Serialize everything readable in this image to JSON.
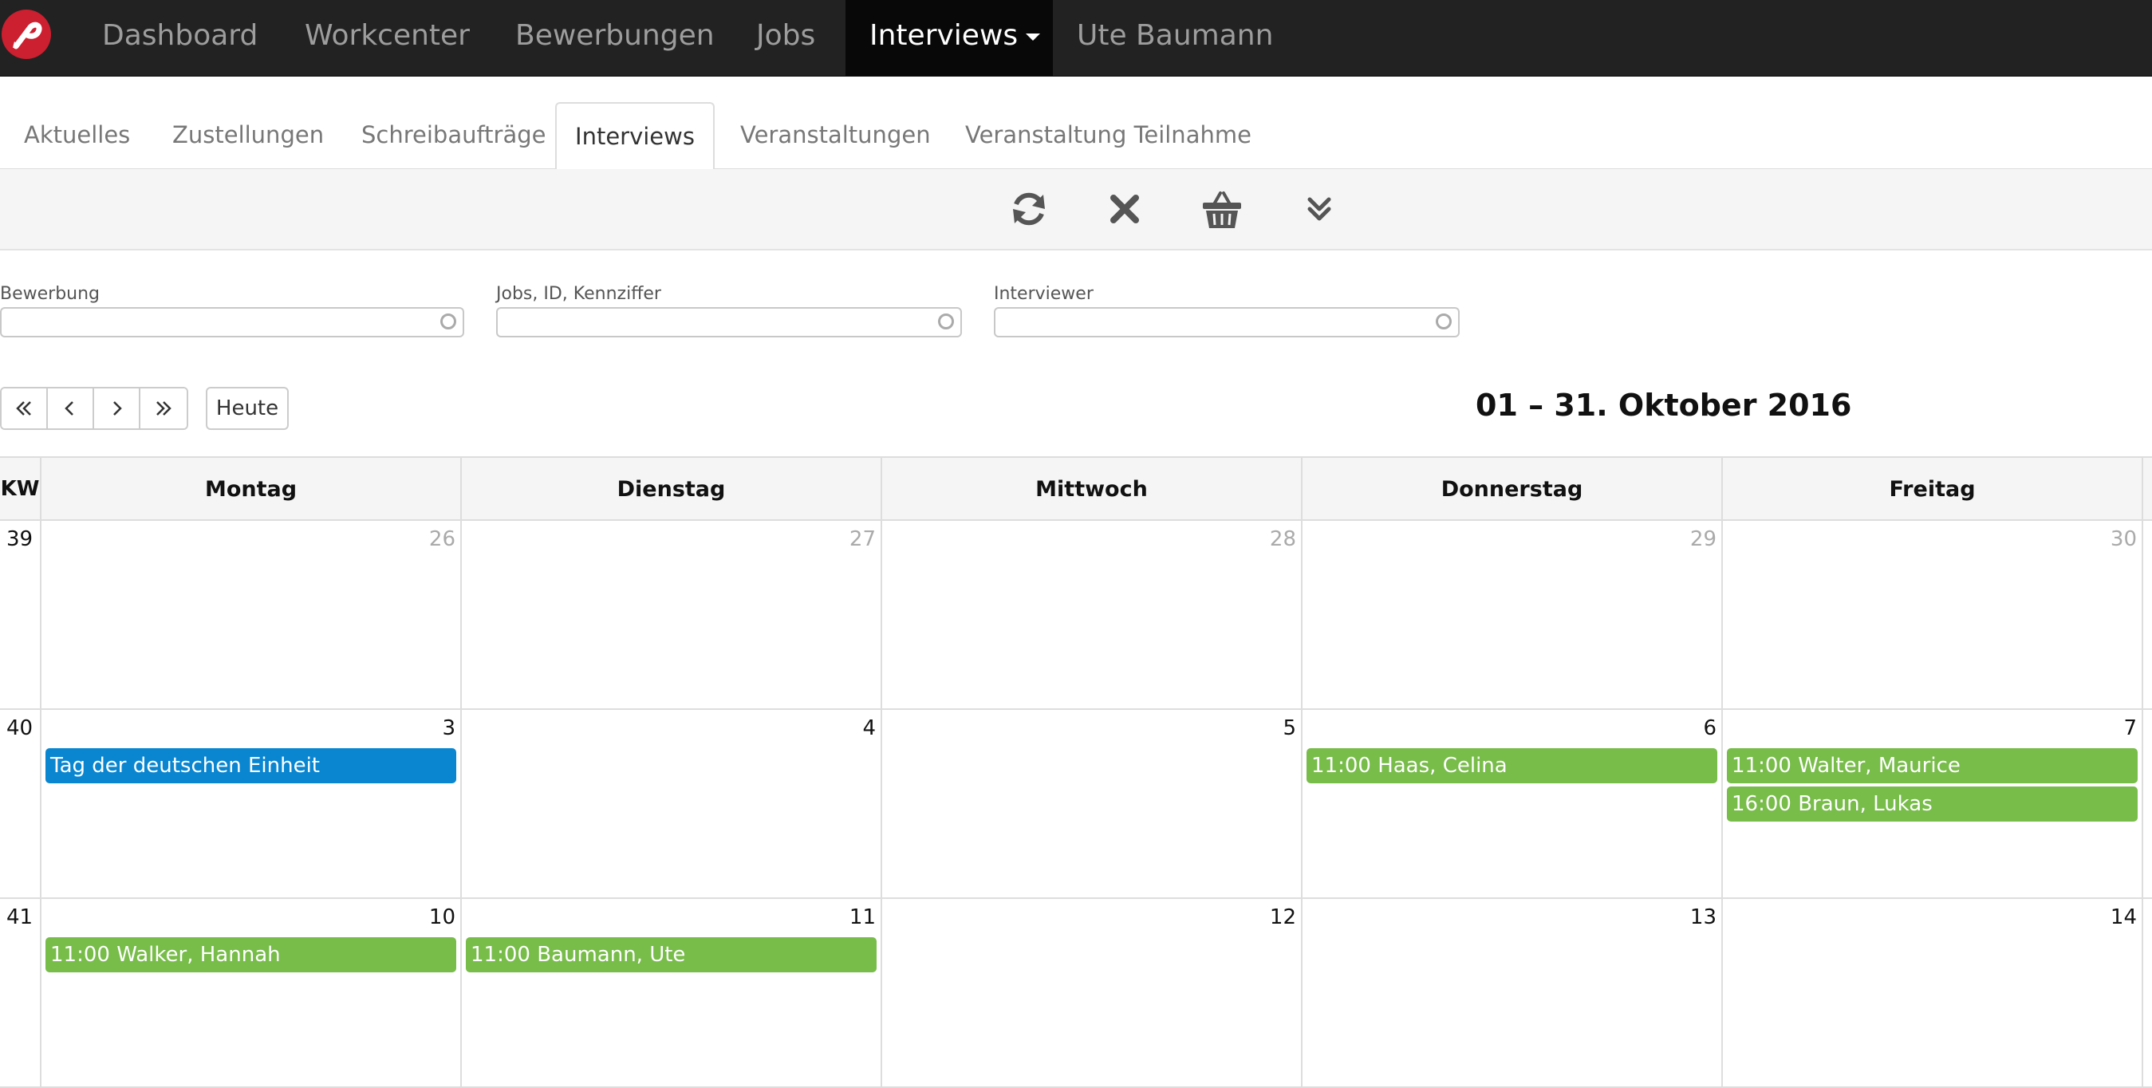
{
  "nav": {
    "items": [
      {
        "label": "Dashboard"
      },
      {
        "label": "Workcenter"
      },
      {
        "label": "Bewerbungen"
      },
      {
        "label": "Jobs"
      },
      {
        "label": "Interviews"
      }
    ],
    "user": "Ute Baumann"
  },
  "tabs": [
    {
      "label": "Aktuelles"
    },
    {
      "label": "Zustellungen"
    },
    {
      "label": "Schreibaufträge"
    },
    {
      "label": "Interviews"
    },
    {
      "label": "Veranstaltungen"
    },
    {
      "label": "Veranstaltung Teilnahme"
    }
  ],
  "toolbar": {
    "icons": [
      "refresh-icon",
      "close-icon",
      "basket-icon",
      "double-chevron-down-icon"
    ]
  },
  "filters": {
    "bewerbung": {
      "label": "Bewerbung",
      "value": ""
    },
    "jobs": {
      "label": "Jobs, ID, Kennziffer",
      "value": ""
    },
    "interviewer": {
      "label": "Interviewer",
      "value": ""
    }
  },
  "calendar": {
    "today_label": "Heute",
    "title": "01 – 31. Oktober 2016",
    "kw_label": "KW",
    "days": [
      "Montag",
      "Dienstag",
      "Mittwoch",
      "Donnerstag",
      "Freitag"
    ],
    "colors": {
      "holiday": "#0a86d1",
      "interview": "#78bc4a"
    },
    "weeks": [
      {
        "kw": "39",
        "dates": [
          "26",
          "27",
          "28",
          "29",
          "30"
        ]
      },
      {
        "kw": "40",
        "dates": [
          "3",
          "4",
          "5",
          "6",
          "7"
        ]
      },
      {
        "kw": "41",
        "dates": [
          "10",
          "11",
          "12",
          "13",
          "14"
        ]
      }
    ],
    "events": {
      "w40_mon": {
        "title": "Tag der deutschen Einheit"
      },
      "w40_thu": {
        "time": "11:00",
        "name": "Haas, Celina"
      },
      "w40_fri_1": {
        "time": "11:00",
        "name": "Walter, Maurice"
      },
      "w40_fri_2": {
        "time": "16:00",
        "name": "Braun, Lukas"
      },
      "w41_mon": {
        "time": "11:00",
        "name": "Walker, Hannah"
      },
      "w41_tue": {
        "time": "11:00",
        "name": "Baumann, Ute"
      }
    }
  }
}
